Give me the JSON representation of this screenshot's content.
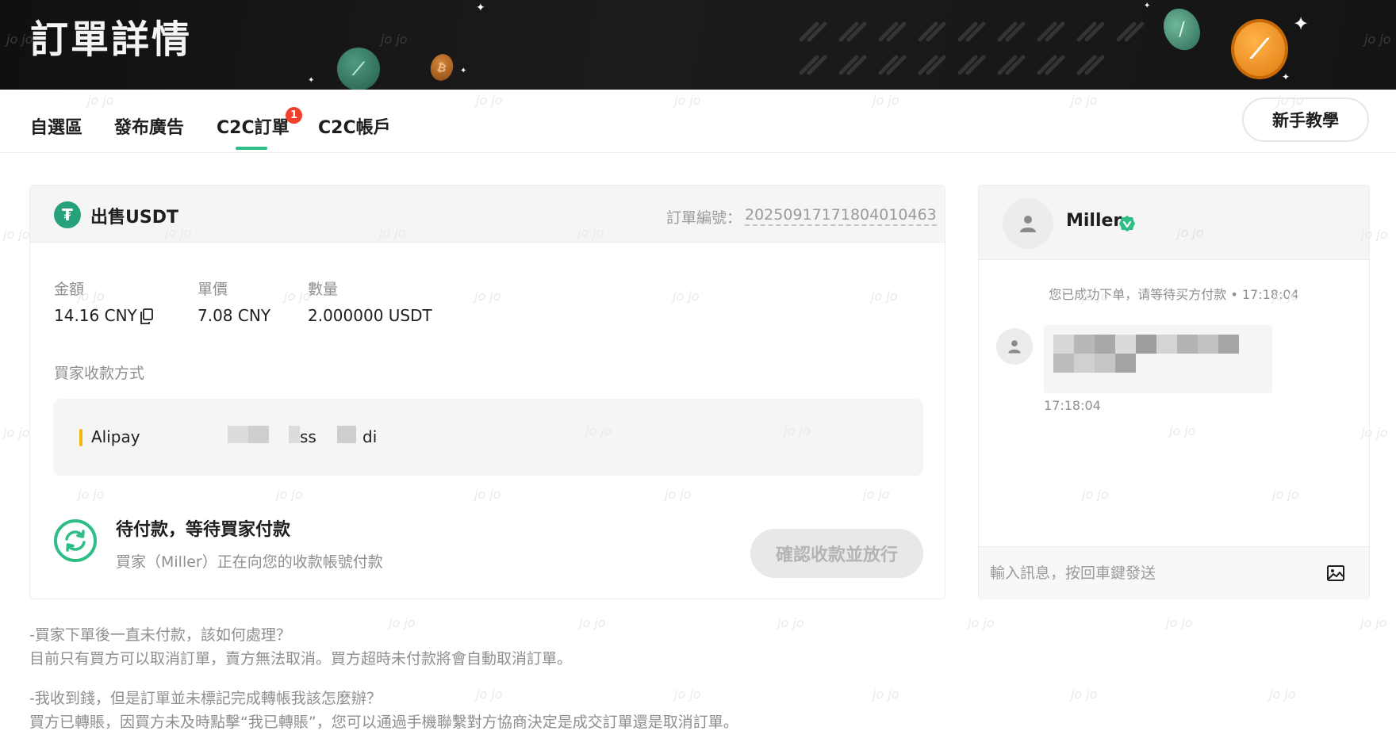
{
  "header": {
    "title": "訂單詳情"
  },
  "nav": {
    "tabs": [
      {
        "label": "自選區"
      },
      {
        "label": "發布廣告"
      },
      {
        "label": "C2C訂單"
      },
      {
        "label": "C2C帳戶"
      }
    ],
    "orders_badge": "1",
    "tutorial_label": "新手教學"
  },
  "order": {
    "title": "出售USDT",
    "order_no_label": "訂單編號：",
    "order_no": "2025091717180401046​3",
    "amount_label": "金額",
    "amount_value": "14.16 CNY",
    "price_label": "單價",
    "price_value": "7.08 CNY",
    "quantity_label": "數量",
    "quantity_value": "2.000000 USDT",
    "payment_label": "買家收款方式",
    "payment_method": "Alipay",
    "payment_fragment_1": "ss",
    "payment_fragment_2": "di",
    "status_title": "待付款，等待買家付款",
    "status_desc": "買家（Miller）正在向您的收款帳號付款",
    "confirm_label": "確認收款並放行"
  },
  "chat": {
    "user_name": "Miller",
    "system_message": "您已成功下单，请等待买方付款 • 17:18:04",
    "message_time": "17:18:04",
    "input_placeholder": "輸入訊息，按回車鍵發送"
  },
  "faq": [
    {
      "question": "-買家下單後一直未付款，該如何處理？",
      "answer": "目前只有買方可以取消訂單，賣方無法取消。買方超時未付款將會自動取消訂單。"
    },
    {
      "question": "-我收到錢，但是訂單並未標記完成轉帳我該怎麼辦？",
      "answer": "買方已轉賬，因買方未及時點擊“我已轉賬”，您可以通過手機聯繫對方協商決定是成交訂單還是取消訂單。"
    }
  ],
  "watermark": "jo jo",
  "colors": {
    "accent": "#2ebd85",
    "badge": "#f0402b",
    "tether": "#26a17b",
    "alipay_bar": "#f0b90b"
  }
}
